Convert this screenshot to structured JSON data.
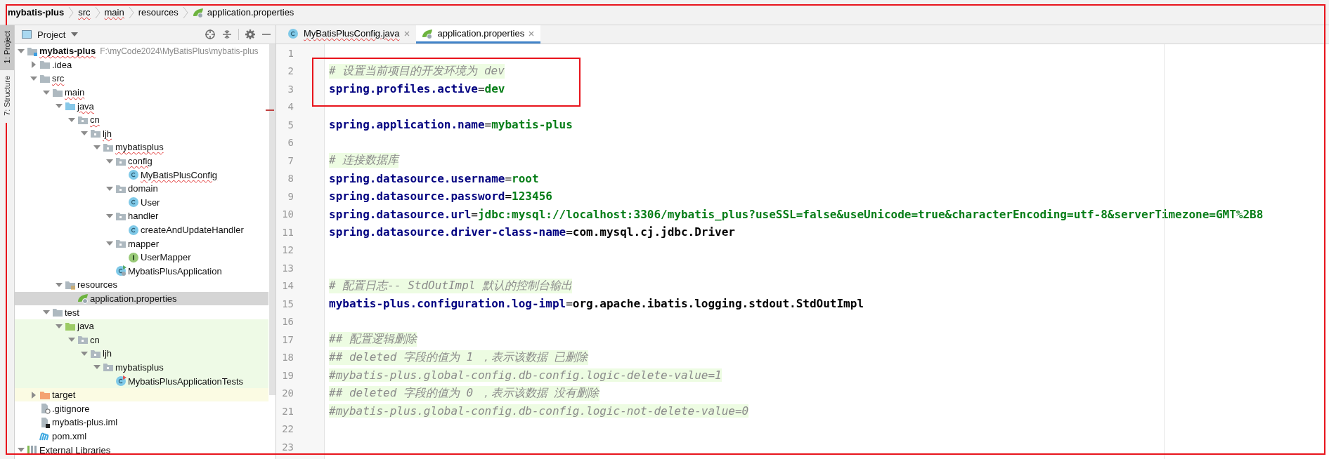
{
  "breadcrumbs": [
    {
      "label": "mybatis-plus",
      "kind": "module",
      "typo": false
    },
    {
      "label": "src",
      "kind": "folder",
      "typo": true
    },
    {
      "label": "main",
      "kind": "folder",
      "typo": true
    },
    {
      "label": "resources",
      "kind": "folder",
      "typo": false
    },
    {
      "label": "application.properties",
      "kind": "properties",
      "typo": false
    }
  ],
  "tool_strip": [
    {
      "label": "1: Project",
      "selected": true
    },
    {
      "label": "7: Structure",
      "selected": false
    }
  ],
  "panel": {
    "title": "Project"
  },
  "tree": [
    {
      "label": "mybatis-plus",
      "kind": "module",
      "path": "F:\\myCode2024\\MyBatisPlus\\mybatis-plus",
      "expanded": true,
      "typo": true,
      "selected": false,
      "children": [
        {
          "label": ".idea",
          "kind": "folder",
          "expanded": false,
          "typo": false,
          "selected": false
        },
        {
          "label": "src",
          "kind": "folder",
          "expanded": true,
          "typo": true,
          "selected": false,
          "children": [
            {
              "label": "main",
              "kind": "folder",
              "expanded": true,
              "typo": true,
              "selected": false,
              "children": [
                {
                  "label": "java",
                  "kind": "source",
                  "expanded": true,
                  "typo": true,
                  "selected": false,
                  "children": [
                    {
                      "label": "cn",
                      "kind": "package",
                      "expanded": true,
                      "typo": true,
                      "selected": false,
                      "children": [
                        {
                          "label": "ljh",
                          "kind": "package",
                          "expanded": true,
                          "typo": true,
                          "selected": false,
                          "children": [
                            {
                              "label": "mybatisplus",
                              "kind": "package",
                              "expanded": true,
                              "typo": true,
                              "selected": false,
                              "children": [
                                {
                                  "label": "config",
                                  "kind": "package",
                                  "expanded": true,
                                  "typo": true,
                                  "selected": false,
                                  "children": [
                                    {
                                      "label": "MyBatisPlusConfig",
                                      "kind": "class",
                                      "typo": true,
                                      "selected": false
                                    }
                                  ]
                                },
                                {
                                  "label": "domain",
                                  "kind": "package",
                                  "expanded": true,
                                  "typo": false,
                                  "selected": false,
                                  "children": [
                                    {
                                      "label": "User",
                                      "kind": "class",
                                      "typo": false,
                                      "selected": false
                                    }
                                  ]
                                },
                                {
                                  "label": "handler",
                                  "kind": "package",
                                  "expanded": true,
                                  "typo": false,
                                  "selected": false,
                                  "children": [
                                    {
                                      "label": "createAndUpdateHandler",
                                      "kind": "class",
                                      "typo": false,
                                      "selected": false
                                    }
                                  ]
                                },
                                {
                                  "label": "mapper",
                                  "kind": "package",
                                  "expanded": true,
                                  "typo": false,
                                  "selected": false,
                                  "children": [
                                    {
                                      "label": "UserMapper",
                                      "kind": "interface",
                                      "typo": false,
                                      "selected": false
                                    }
                                  ]
                                },
                                {
                                  "label": "MybatisPlusApplication",
                                  "kind": "app",
                                  "typo": false,
                                  "selected": false
                                }
                              ]
                            }
                          ]
                        }
                      ]
                    }
                  ]
                },
                {
                  "label": "resources",
                  "kind": "resources",
                  "expanded": true,
                  "typo": false,
                  "selected": false,
                  "children": [
                    {
                      "label": "application.properties",
                      "kind": "properties",
                      "typo": false,
                      "selected": true
                    }
                  ]
                }
              ]
            },
            {
              "label": "test",
              "kind": "folder",
              "expanded": true,
              "typo": false,
              "selected": false,
              "children": [
                {
                  "label": "java",
                  "kind": "test-source",
                  "expanded": true,
                  "typo": false,
                  "selected": false,
                  "children": [
                    {
                      "label": "cn",
                      "kind": "package",
                      "expanded": true,
                      "typo": false,
                      "selected": false,
                      "children": [
                        {
                          "label": "ljh",
                          "kind": "package",
                          "expanded": true,
                          "typo": false,
                          "selected": false,
                          "children": [
                            {
                              "label": "mybatisplus",
                              "kind": "package",
                              "expanded": true,
                              "typo": false,
                              "selected": false,
                              "children": [
                                {
                                  "label": "MybatisPlusApplicationTests",
                                  "kind": "test-class",
                                  "typo": false,
                                  "selected": false
                                }
                              ]
                            }
                          ]
                        }
                      ]
                    }
                  ]
                }
              ]
            }
          ]
        },
        {
          "label": "target",
          "kind": "excluded",
          "expanded": false,
          "typo": false,
          "selected": false
        },
        {
          "label": ".gitignore",
          "kind": "gitignore",
          "typo": false,
          "selected": false
        },
        {
          "label": "mybatis-plus.iml",
          "kind": "iml",
          "typo": false,
          "selected": false
        },
        {
          "label": "pom.xml",
          "kind": "maven",
          "typo": false,
          "selected": false
        }
      ]
    },
    {
      "label": "External Libraries",
      "kind": "libraries",
      "expanded": true,
      "typo": false,
      "selected": false
    }
  ],
  "tabs": [
    {
      "label": "MyBatisPlusConfig.java",
      "kind": "class",
      "typo": true,
      "selected": false
    },
    {
      "label": "application.properties",
      "kind": "properties",
      "typo": false,
      "selected": true
    }
  ],
  "lines": [
    {
      "number": "1"
    },
    {
      "number": "2",
      "kind": "comment",
      "text": "# 设置当前项目的开发环境为 dev"
    },
    {
      "number": "3",
      "kind": "property",
      "key": "spring.profiles.active",
      "sep": "=",
      "value": "dev",
      "string_value": true
    },
    {
      "number": "4"
    },
    {
      "number": "5",
      "kind": "property",
      "key": "spring.application.name",
      "sep": "=",
      "value": "mybatis-plus",
      "string_value": true
    },
    {
      "number": "6"
    },
    {
      "number": "7",
      "kind": "comment",
      "text": "# 连接数据库"
    },
    {
      "number": "8",
      "kind": "property",
      "key": "spring.datasource.username",
      "sep": "=",
      "value": "root",
      "string_value": true
    },
    {
      "number": "9",
      "kind": "property",
      "key": "spring.datasource.password",
      "sep": "=",
      "value": "123456",
      "string_value": true
    },
    {
      "number": "10",
      "kind": "property",
      "key": "spring.datasource.url",
      "sep": "=",
      "value": "jdbc:mysql://localhost:3306/mybatis_plus?useSSL=false&useUnicode=true&characterEncoding=utf-8&serverTimezone=GMT%2B8",
      "string_value": true
    },
    {
      "number": "11",
      "kind": "property",
      "key": "spring.datasource.driver-class-name",
      "sep": "=",
      "value": "com.mysql.cj.jdbc.Driver",
      "string_value": false
    },
    {
      "number": "12"
    },
    {
      "number": "13"
    },
    {
      "number": "14",
      "kind": "comment",
      "text": "# 配置日志-- StdOutImpl 默认的控制台输出"
    },
    {
      "number": "15",
      "kind": "property",
      "key": "mybatis-plus.configuration.log-impl",
      "sep": "=",
      "value": "org.apache.ibatis.logging.stdout.StdOutImpl",
      "string_value": false
    },
    {
      "number": "16"
    },
    {
      "number": "17",
      "kind": "comment",
      "text": "## 配置逻辑删除"
    },
    {
      "number": "18",
      "kind": "comment",
      "text": "## deleted 字段的值为 1 ，表示该数据 已删除"
    },
    {
      "number": "19",
      "kind": "comment",
      "text": "#mybatis-plus.global-config.db-config.logic-delete-value=1"
    },
    {
      "number": "20",
      "kind": "comment",
      "text": "## deleted 字段的值为 0 ，表示该数据 没有删除"
    },
    {
      "number": "21",
      "kind": "comment",
      "text": "#mybatis-plus.global-config.db-config.logic-not-delete-value=0"
    },
    {
      "number": "22"
    },
    {
      "number": "23"
    }
  ]
}
